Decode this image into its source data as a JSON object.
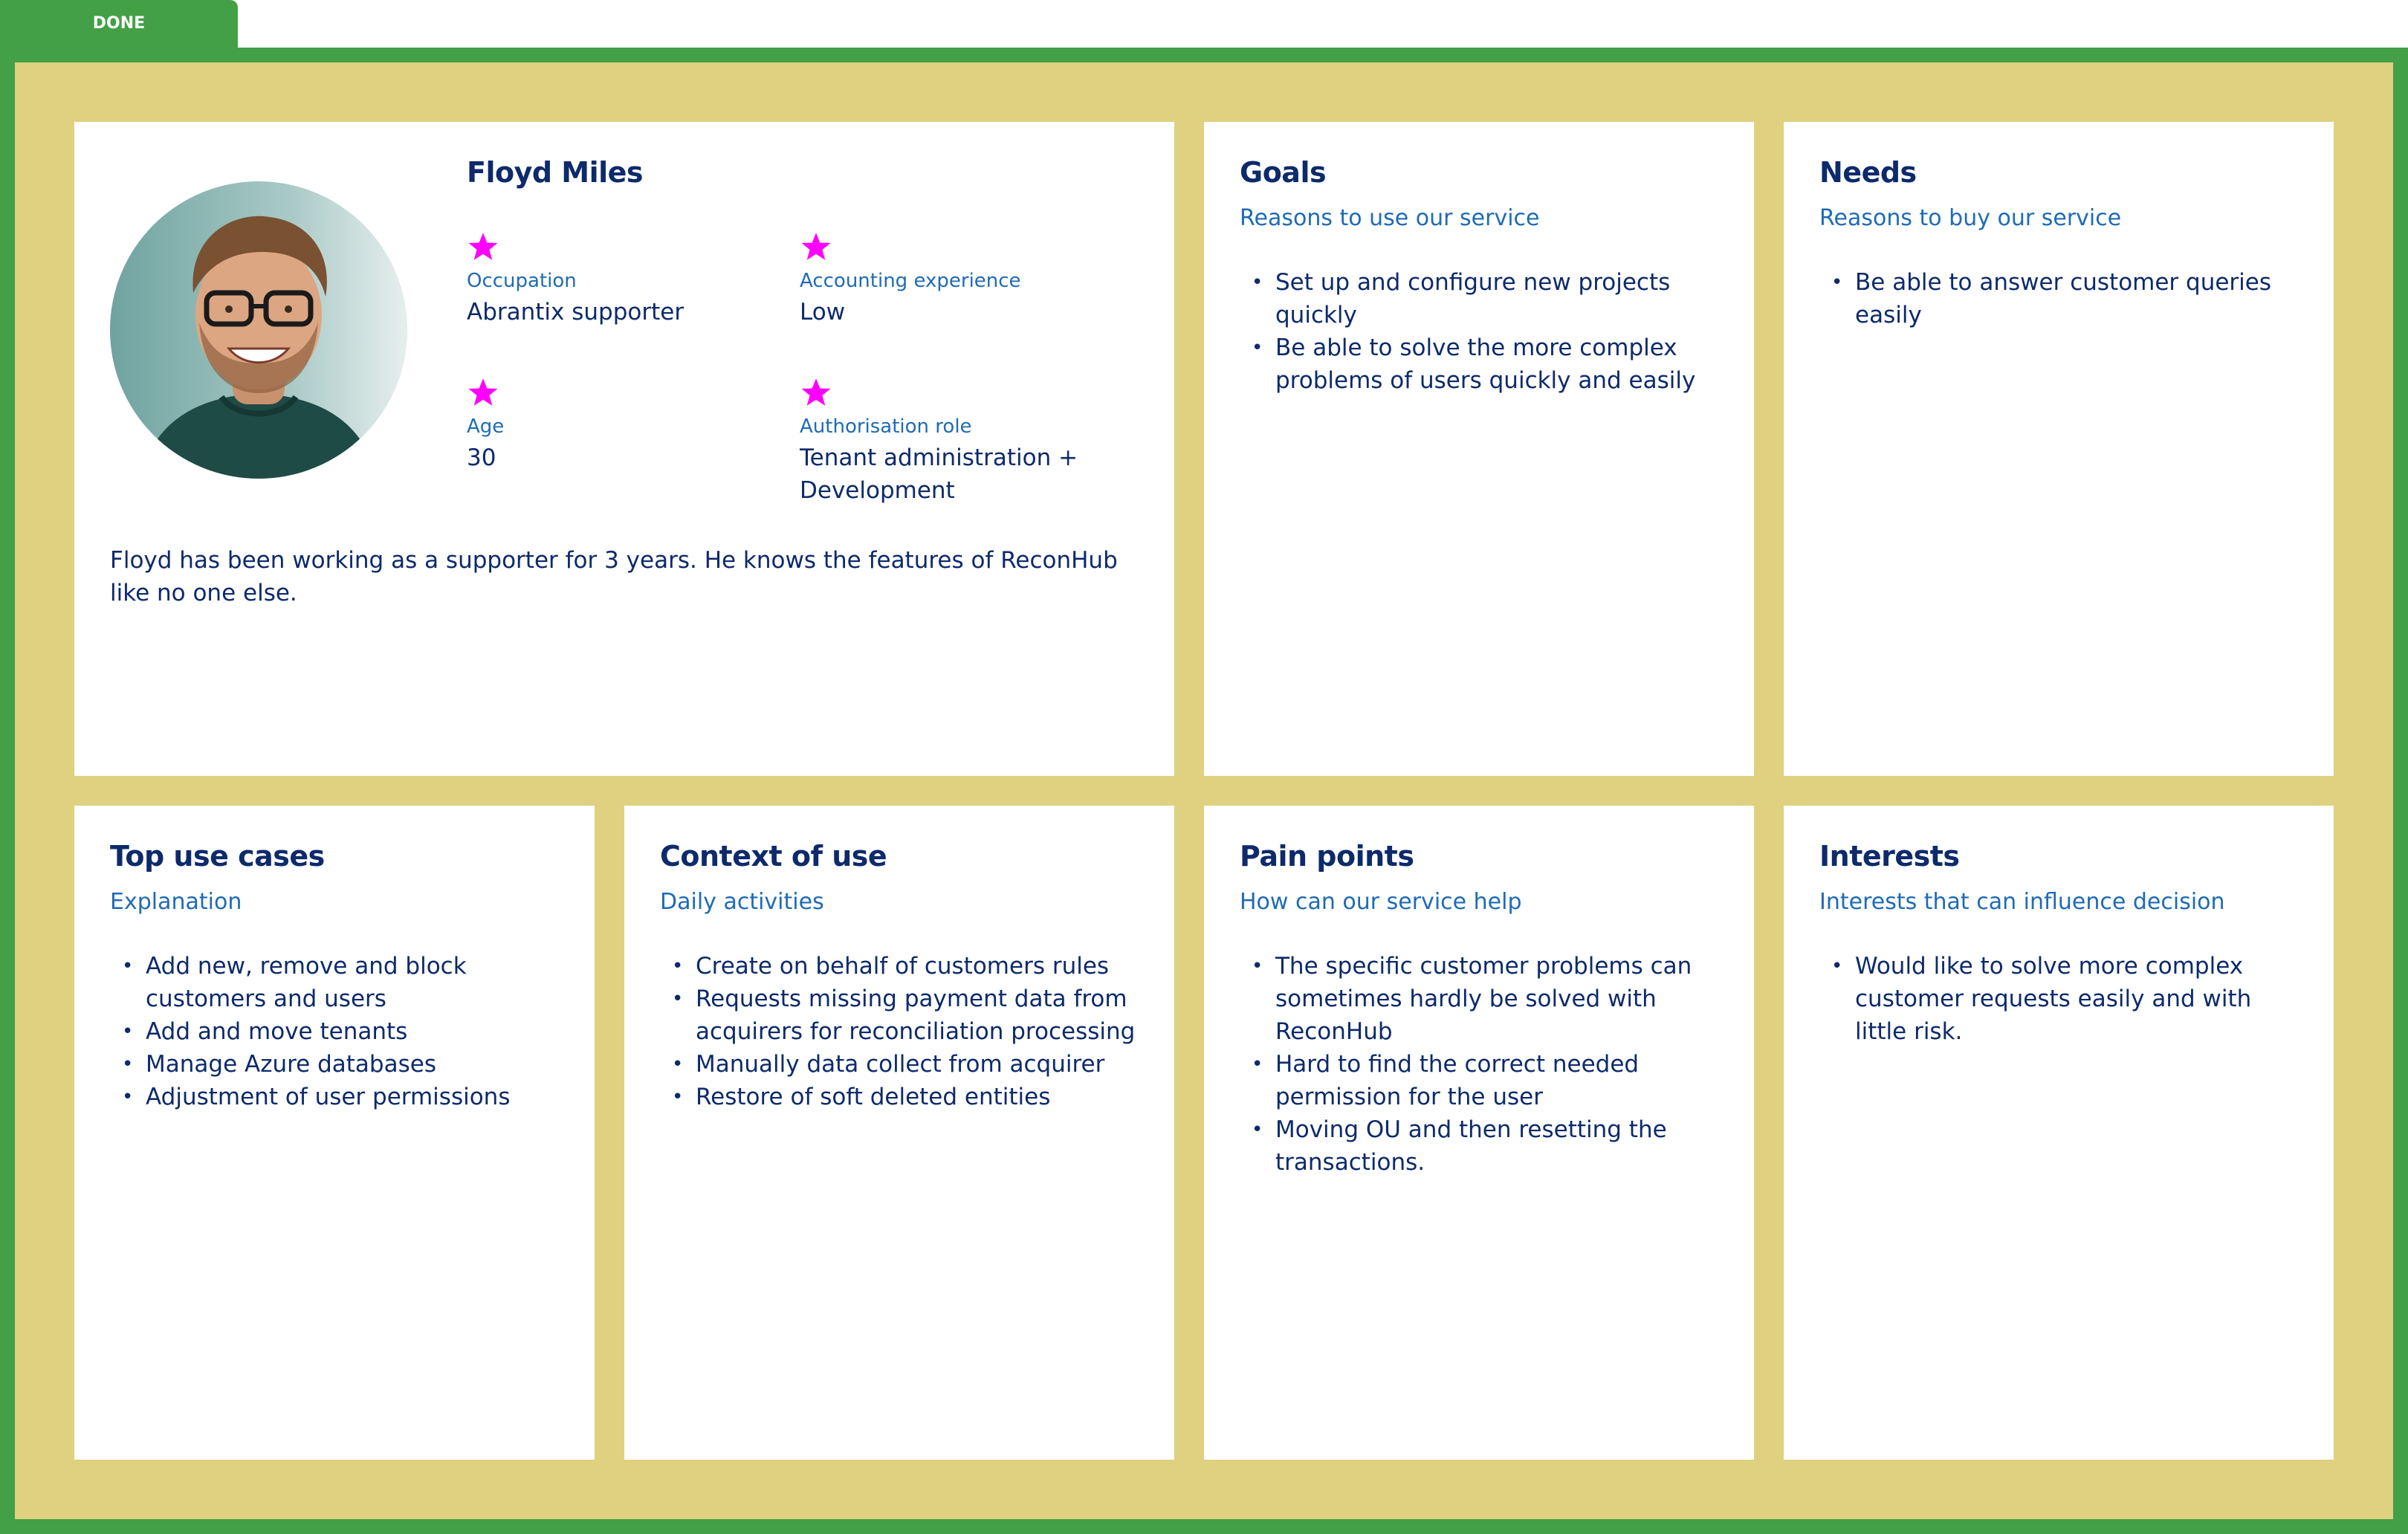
{
  "status_tab": {
    "label": "DONE"
  },
  "colors": {
    "frame": "#43a047",
    "board": "#dfd17f",
    "card": "#ffffff",
    "text": "#0d2a6b",
    "subtext": "#1f6bb5",
    "star": "#ff00ff"
  },
  "persona": {
    "name": "Floyd Miles",
    "photo_icon": "avatar-photo",
    "attributes": [
      {
        "icon": "star-icon",
        "label": "Occupation",
        "value": "Abrantix supporter"
      },
      {
        "icon": "star-icon",
        "label": "Accounting experience",
        "value": "Low"
      },
      {
        "icon": "star-icon",
        "label": "Age",
        "value": "30"
      },
      {
        "icon": "star-icon",
        "label": "Authorisation role",
        "value": "Tenant administration + Development"
      }
    ],
    "description": "Floyd has been working as a supporter for 3 years. He knows the features of ReconHub like no one else."
  },
  "goals": {
    "title": "Goals",
    "subtitle": "Reasons to use our service",
    "items": [
      "Set up and configure new projects quickly",
      "Be able to solve the more complex problems of users quickly and easily"
    ]
  },
  "needs": {
    "title": "Needs",
    "subtitle": "Reasons to buy our service",
    "items": [
      "Be able to answer customer queries easily"
    ]
  },
  "use_cases": {
    "title": "Top use cases",
    "subtitle": "Explanation",
    "items": [
      "Add new, remove and block customers and users",
      "Add and move tenants",
      "Manage Azure databases",
      "Adjustment of user permissions"
    ]
  },
  "context": {
    "title": "Context of use",
    "subtitle": "Daily activities",
    "items": [
      "Create on behalf of customers rules",
      "Requests missing payment data from acquirers for reconciliation processing",
      "Manually data collect from acquirer",
      "Restore of soft deleted entities"
    ]
  },
  "pain_points": {
    "title": "Pain points",
    "subtitle": "How can our service help",
    "items": [
      "The specific customer problems can sometimes hardly be solved with ReconHub",
      "Hard to find the correct needed permission for the user",
      "Moving OU and then resetting the transactions."
    ]
  },
  "interests": {
    "title": "Interests",
    "subtitle": "Interests that can influence decision",
    "items": [
      "Would like to solve more complex customer requests easily and with little risk."
    ]
  }
}
